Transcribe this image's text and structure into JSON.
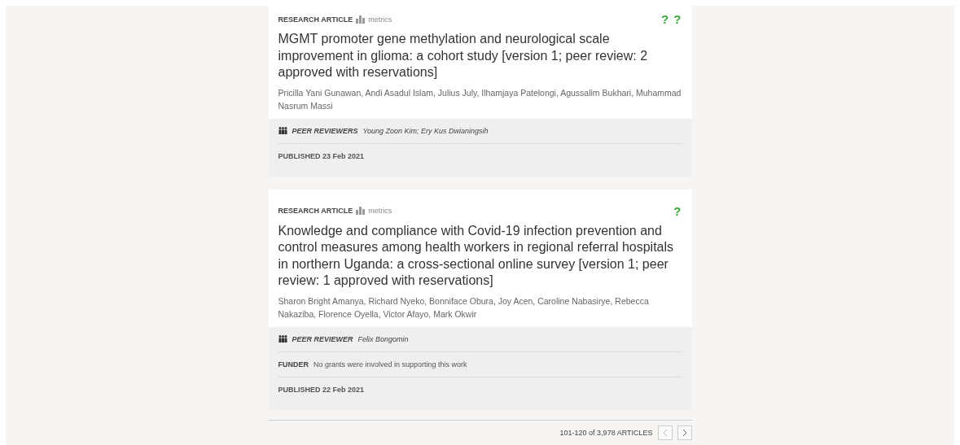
{
  "articles": [
    {
      "type": "RESEARCH ARTICLE",
      "metrics": "metrics",
      "status": "? ?",
      "title": "MGMT promoter gene methylation and neurological scale improvement in glioma: a cohort study [version 1; peer review: 2 approved with reservations]",
      "authors": "Pricilla Yani Gunawan, Andi Asadul Islam, Julius July, Ilhamjaya Patelongi, Agussalim Bukhari, Muhammad Nasrum Massi",
      "reviewers_label": "PEER REVIEWERS",
      "reviewers": "Young Zoon Kim; Ery Kus Dwianingsih",
      "published": "PUBLISHED 23 Feb 2021"
    },
    {
      "type": "RESEARCH ARTICLE",
      "metrics": "metrics",
      "status": "?",
      "title": "Knowledge and compliance with Covid-19 infection prevention and control measures among health workers in regional referral hospitals in northern Uganda: a cross-sectional online survey [version 1; peer review: 1 approved with reservations]",
      "authors": "Sharon Bright Amanya, Richard Nyeko, Bonniface Obura, Joy Acen, Caroline Nabasirye, Rebecca Nakaziba, Florence Oyella, Victor Afayo, Mark Okwir",
      "reviewers_label": "PEER REVIEWER",
      "reviewers": "Felix Bongomin",
      "funder_label": "FUNDER",
      "funder": "No grants were involved in supporting this work",
      "published": "PUBLISHED 22 Feb 2021"
    }
  ],
  "pagination": {
    "range": "101-120 of 3,978 ARTICLES",
    "prev_disabled": true
  }
}
